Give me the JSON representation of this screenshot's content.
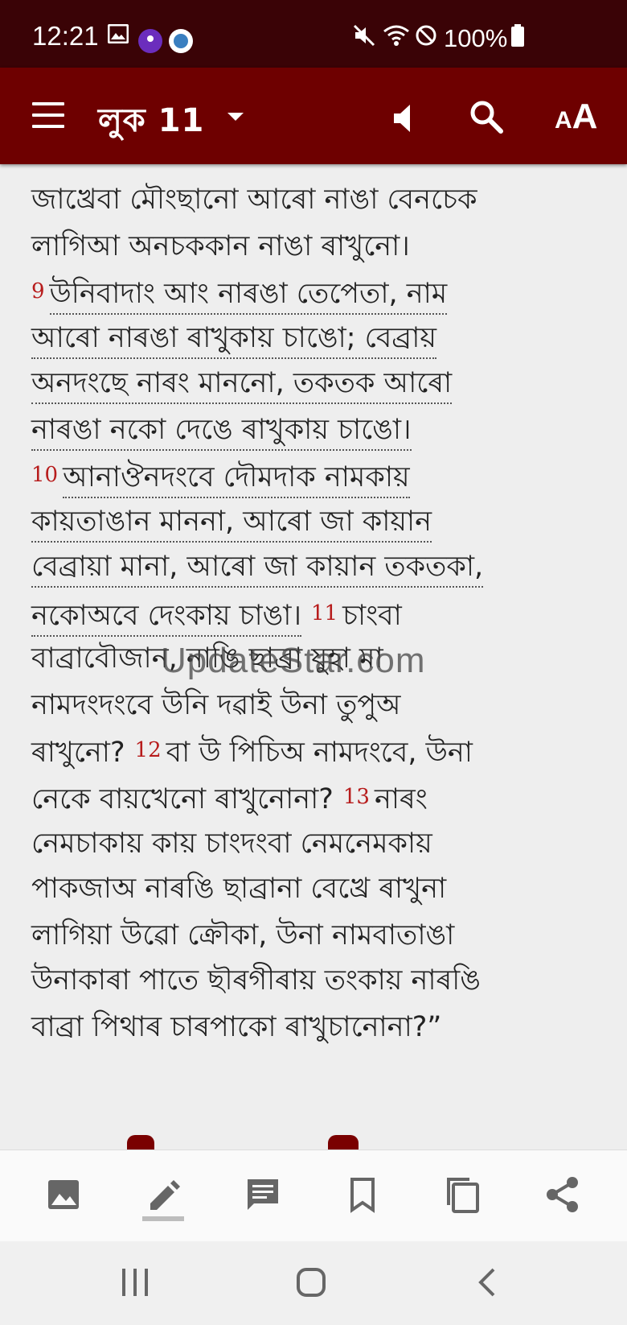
{
  "status_bar": {
    "time": "12:21",
    "battery": "100%",
    "icons": [
      "gallery-icon",
      "app-icon",
      "app-icon-2",
      "mute-icon",
      "wifi-icon",
      "dnd-icon",
      "battery-icon"
    ]
  },
  "app_bar": {
    "book_chapter": "লুক 11",
    "icons": [
      "menu-icon",
      "dropdown-caret-icon",
      "speaker-icon",
      "search-icon",
      "font-size-icon"
    ],
    "font_label_small": "A",
    "font_label_big": "A"
  },
  "content": {
    "lines": [
      {
        "text": "জাখ্রেবা মৌংছানো আৰো নাঙা বেনচেক",
        "underline": false
      },
      {
        "text": "লাগিআ অনচককান নাঙা ৰাখুনো।",
        "underline": false
      },
      {
        "verse": "9",
        "text": "উনিবাদাং আং নাৰঙা তেপেতা, নাম",
        "underline": true
      },
      {
        "text": "আৰো নাৰঙা ৰাখুকায় চাঙো; বেব্রায়",
        "underline": true
      },
      {
        "text": "অনদংছে নাৰং মাননো, তকতক আৰো",
        "underline": true
      },
      {
        "text": "নাৰঙা নকো দেঙে ৰাখুকায় চাঙো।",
        "underline": true
      },
      {
        "verse": "10",
        "text": "আনাঔনদংবে দৌমদাক নামকায়",
        "underline": true
      },
      {
        "text": "কায়তাঙান মাননা, আৰো জা কায়ান",
        "underline": true
      },
      {
        "text": "বেব্রায়া মানা, আৰো জা কায়ান তকতকা,",
        "underline": true
      },
      {
        "text": "নকোঅবে দেংকায় চাঙা।",
        "underline": true,
        "tail_verse": "11",
        "tail": "চাংবা"
      },
      {
        "text": "বাব্রাবৌজান, নাঙি ছাব্রা যুহা মা",
        "underline": false
      },
      {
        "text": "নামদংদংবে উনি দৱাই উনা তুপুঅ",
        "underline": false
      },
      {
        "text": "ৰাখুনো?",
        "underline": false,
        "tail_verse": "12",
        "tail": "বা উ পিচিঅ নামদংবে, উনা"
      },
      {
        "text": "নেকে বায়খেনো ৰাখুনোনা?",
        "underline": false,
        "tail_verse": "13",
        "tail": "নাৰং"
      },
      {
        "text": "নেমচাকায় কায় চাংদংবা নেমনেমকায়",
        "underline": false
      },
      {
        "text": "পাকজাঅ নাৰঙি ছাব্রানা বেখ্রে ৰাখুনা",
        "underline": false
      },
      {
        "text": "লাগিয়া উৱো ক্রৌকা, উনা নামবাতাঙা",
        "underline": false
      },
      {
        "text": "উনাকাৰা পাতে ছৗৰগীৰায় তংকায় নাৰঙি",
        "underline": false
      },
      {
        "text": "বাব্রা পিথাৰ চাৰপাকো ৰাখুচানোনা?”",
        "underline": false
      }
    ],
    "watermark": "UpdateStar.com"
  },
  "toolbar": {
    "items": [
      "image-icon",
      "highlight-pen-icon",
      "note-icon",
      "bookmark-icon",
      "copy-icon",
      "share-icon"
    ]
  },
  "nav_bar": {
    "items": [
      "recent-apps-icon",
      "home-icon",
      "back-icon"
    ]
  }
}
